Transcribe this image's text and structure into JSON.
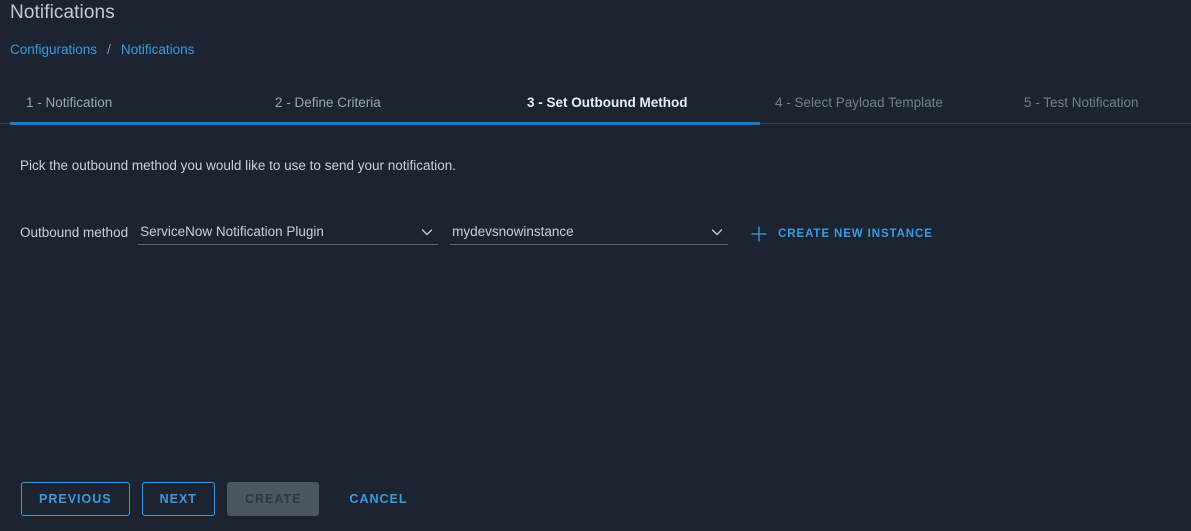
{
  "header": {
    "title": "Notifications",
    "breadcrumb": {
      "root": "Configurations",
      "separator": "/",
      "current": "Notifications"
    }
  },
  "tabs": [
    {
      "label": "1 - Notification",
      "state": "done"
    },
    {
      "label": "2 - Define Criteria",
      "state": "done"
    },
    {
      "label": "3 - Set Outbound Method",
      "state": "active"
    },
    {
      "label": "4 - Select Payload Template",
      "state": "upcoming"
    },
    {
      "label": "5 - Test Notification",
      "state": "upcoming"
    }
  ],
  "main": {
    "intro": "Pick the outbound method you would like to use to send your notification.",
    "outbound_method": {
      "label": "Outbound method",
      "plugin_select": {
        "value": "ServiceNow Notification Plugin",
        "icon": "chevron-down-icon"
      },
      "instance_select": {
        "value": "mydevsnowinstance",
        "icon": "chevron-down-icon"
      },
      "create_instance": {
        "label": "CREATE NEW INSTANCE",
        "icon": "plus-icon"
      }
    }
  },
  "footer": {
    "previous": "PREVIOUS",
    "next": "NEXT",
    "create": "CREATE",
    "cancel": "CANCEL"
  },
  "colors": {
    "background": "#1b2430",
    "accent": "#3a9ae0",
    "active_underline": "#1a7bbd",
    "text_primary": "#c8d0d8",
    "text_muted": "#737f8b",
    "disabled_button_bg": "#4c565f"
  }
}
